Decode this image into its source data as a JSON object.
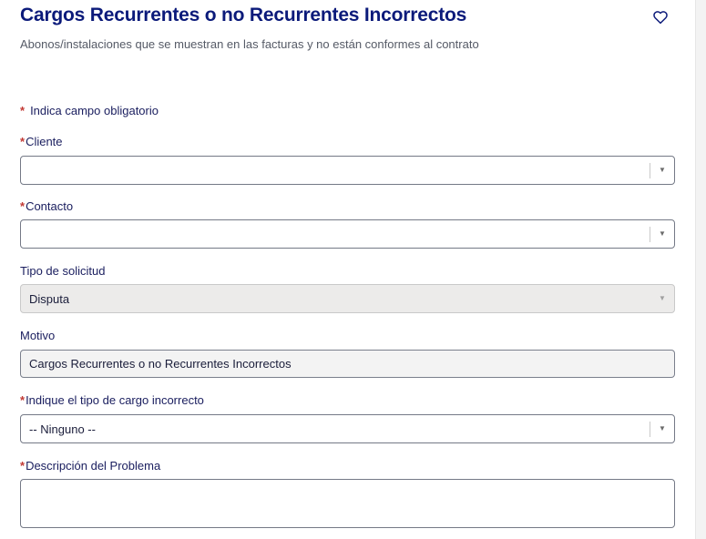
{
  "header": {
    "title": "Cargos Recurrentes o no Recurrentes Incorrectos",
    "subtitle": "Abonos/instalaciones que se muestran en las facturas y no están conformes al contrato",
    "favorite_icon": "heart-icon"
  },
  "form": {
    "required_star": "*",
    "required_note": "Indica campo obligatorio",
    "cliente": {
      "label": "Cliente",
      "value": ""
    },
    "contacto": {
      "label": "Contacto",
      "value": ""
    },
    "tipo_solicitud": {
      "label": "Tipo de solicitud",
      "value": "Disputa"
    },
    "motivo": {
      "label": "Motivo",
      "value": "Cargos Recurrentes o no Recurrentes Incorrectos"
    },
    "tipo_cargo": {
      "label": "Indique el tipo de cargo incorrecto",
      "value": "-- Ninguno --"
    },
    "descripcion": {
      "label": "Descripción del Problema",
      "value": ""
    },
    "dropdown_icon": "caret-down-icon"
  },
  "colors": {
    "title": "#0b1a7a",
    "label": "#1c2060",
    "required": "#c23934"
  }
}
